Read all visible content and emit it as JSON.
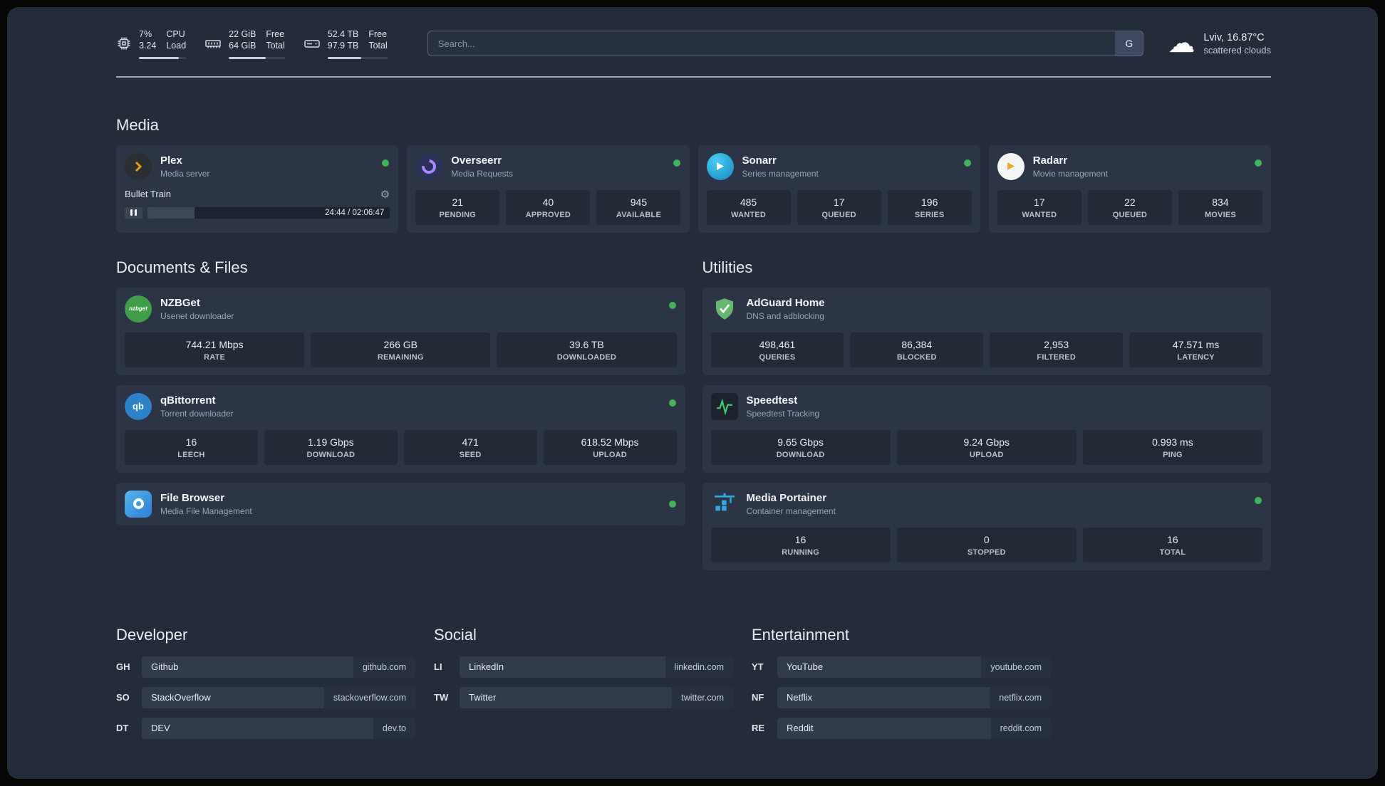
{
  "colors": {
    "status_online": "#3fb45a",
    "plex_accent": "#e5a00d",
    "page_background": "#242c3c",
    "card_background": "#2b3546"
  },
  "topbar": {
    "cpu": {
      "value1": "7%",
      "value2": "3.24",
      "label1": "CPU",
      "label2": "Load",
      "bar_pct": 84
    },
    "ram": {
      "value1": "22 GiB",
      "value2": "64 GiB",
      "label1": "Free",
      "label2": "Total",
      "bar_pct": 66
    },
    "disk": {
      "value1": "52.4 TB",
      "value2": "97.9 TB",
      "label1": "Free",
      "label2": "Total",
      "bar_pct": 56
    },
    "search": {
      "placeholder": "Search...",
      "button_label": "G"
    },
    "weather": {
      "location": "Lviv, 16.87°C",
      "condition": "scattered clouds"
    }
  },
  "media": {
    "heading": "Media",
    "plex": {
      "name": "Plex",
      "subtitle": "Media server",
      "now_playing": "Bullet Train",
      "time": "24:44 / 02:06:47",
      "progress_pct": 19.5
    },
    "overseerr": {
      "name": "Overseerr",
      "subtitle": "Media Requests",
      "stats": [
        {
          "value": "21",
          "label": "PENDING"
        },
        {
          "value": "40",
          "label": "APPROVED"
        },
        {
          "value": "945",
          "label": "AVAILABLE"
        }
      ]
    },
    "sonarr": {
      "name": "Sonarr",
      "subtitle": "Series management",
      "stats": [
        {
          "value": "485",
          "label": "WANTED"
        },
        {
          "value": "17",
          "label": "QUEUED"
        },
        {
          "value": "196",
          "label": "SERIES"
        }
      ]
    },
    "radarr": {
      "name": "Radarr",
      "subtitle": "Movie management",
      "stats": [
        {
          "value": "17",
          "label": "WANTED"
        },
        {
          "value": "22",
          "label": "QUEUED"
        },
        {
          "value": "834",
          "label": "MOVIES"
        }
      ]
    }
  },
  "documents": {
    "heading": "Documents & Files",
    "nzbget": {
      "name": "NZBGet",
      "subtitle": "Usenet downloader",
      "icon_text": "nzbget",
      "stats": [
        {
          "value": "744.21 Mbps",
          "label": "RATE"
        },
        {
          "value": "266 GB",
          "label": "REMAINING"
        },
        {
          "value": "39.6 TB",
          "label": "DOWNLOADED"
        }
      ]
    },
    "qbittorrent": {
      "name": "qBittorrent",
      "subtitle": "Torrent downloader",
      "icon_text": "qb",
      "stats": [
        {
          "value": "16",
          "label": "LEECH"
        },
        {
          "value": "1.19 Gbps",
          "label": "DOWNLOAD"
        },
        {
          "value": "471",
          "label": "SEED"
        },
        {
          "value": "618.52 Mbps",
          "label": "UPLOAD"
        }
      ]
    },
    "filebrowser": {
      "name": "File Browser",
      "subtitle": "Media File Management"
    }
  },
  "utilities": {
    "heading": "Utilities",
    "adguard": {
      "name": "AdGuard Home",
      "subtitle": "DNS and adblocking",
      "stats": [
        {
          "value": "498,461",
          "label": "QUERIES"
        },
        {
          "value": "86,384",
          "label": "BLOCKED"
        },
        {
          "value": "2,953",
          "label": "FILTERED"
        },
        {
          "value": "47.571 ms",
          "label": "LATENCY"
        }
      ]
    },
    "speedtest": {
      "name": "Speedtest",
      "subtitle": "Speedtest Tracking",
      "stats": [
        {
          "value": "9.65 Gbps",
          "label": "DOWNLOAD"
        },
        {
          "value": "9.24 Gbps",
          "label": "UPLOAD"
        },
        {
          "value": "0.993 ms",
          "label": "PING"
        }
      ]
    },
    "portainer": {
      "name": "Media Portainer",
      "subtitle": "Container management",
      "stats": [
        {
          "value": "16",
          "label": "RUNNING"
        },
        {
          "value": "0",
          "label": "STOPPED"
        },
        {
          "value": "16",
          "label": "TOTAL"
        }
      ]
    }
  },
  "bookmarks": {
    "developer": {
      "heading": "Developer",
      "items": [
        {
          "abbr": "GH",
          "name": "Github",
          "url": "github.com"
        },
        {
          "abbr": "SO",
          "name": "StackOverflow",
          "url": "stackoverflow.com"
        },
        {
          "abbr": "DT",
          "name": "DEV",
          "url": "dev.to"
        }
      ]
    },
    "social": {
      "heading": "Social",
      "items": [
        {
          "abbr": "LI",
          "name": "LinkedIn",
          "url": "linkedin.com"
        },
        {
          "abbr": "TW",
          "name": "Twitter",
          "url": "twitter.com"
        }
      ]
    },
    "entertainment": {
      "heading": "Entertainment",
      "items": [
        {
          "abbr": "YT",
          "name": "YouTube",
          "url": "youtube.com"
        },
        {
          "abbr": "NF",
          "name": "Netflix",
          "url": "netflix.com"
        },
        {
          "abbr": "RE",
          "name": "Reddit",
          "url": "reddit.com"
        }
      ]
    }
  }
}
